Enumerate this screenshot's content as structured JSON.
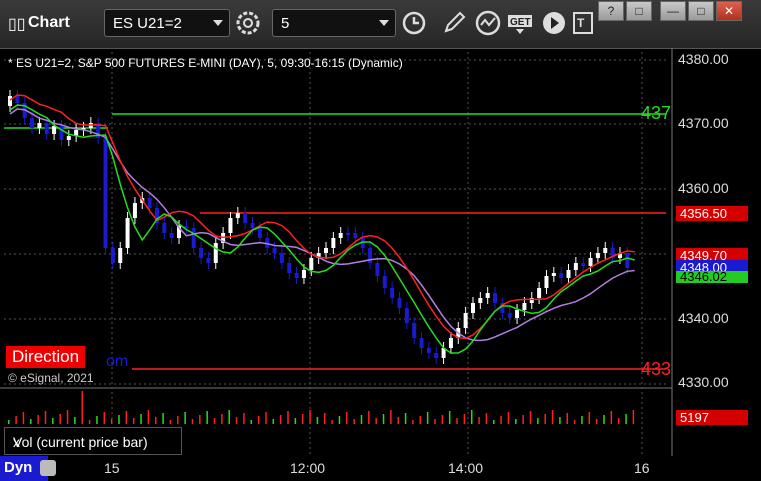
{
  "app": {
    "title": "Chart"
  },
  "toolbar": {
    "symbol": "ES U21=2",
    "interval": "5",
    "icons": [
      "gear-icon",
      "clock-icon",
      "pencil-icon",
      "study-icon",
      "get-icon",
      "play-icon",
      "template-icon"
    ],
    "window_controls": [
      "?",
      "□",
      "—",
      "□",
      "✕"
    ]
  },
  "chart": {
    "header": "* ES U21=2, S&P 500 FUTURES E-MINI (DAY), 5, 09:30-16:15 (Dynamic)",
    "copyright": "© eSignal, 2021",
    "direction_label": "Direction",
    "direction_suffix": "om",
    "price_axis": [
      "4380.00",
      "4370.00",
      "4360.00",
      "4340.00",
      "4330.00"
    ],
    "tags": [
      {
        "value": "4356.50",
        "bg": "#d40000",
        "fg": "#ffffff"
      },
      {
        "value": "4349.70",
        "bg": "#d40000",
        "fg": "#ffffff"
      },
      {
        "value": "4348.00",
        "bg": "#1a1ad0",
        "fg": "#ffffff"
      },
      {
        "value": "4346.02",
        "bg": "#22cc22",
        "fg": "#000000"
      },
      {
        "value": "5197",
        "bg": "#d40000",
        "fg": "#ffffff"
      }
    ],
    "line_labels": {
      "green": "437",
      "red": "433"
    },
    "colors": {
      "up": "#ffffff",
      "down": "#1a1ad0",
      "ma_red": "#ff2020",
      "ma_green": "#22dd22",
      "ma_purple": "#b080e0",
      "level_green": "#22dd22",
      "level_red": "#ff2020"
    }
  },
  "volume": {
    "label": "Vol (current price bar)",
    "close": "x"
  },
  "xaxis": {
    "labels": [
      "15",
      "12:00",
      "14:00",
      "16"
    ]
  },
  "footer": {
    "dyn_label": "Dyn"
  }
}
